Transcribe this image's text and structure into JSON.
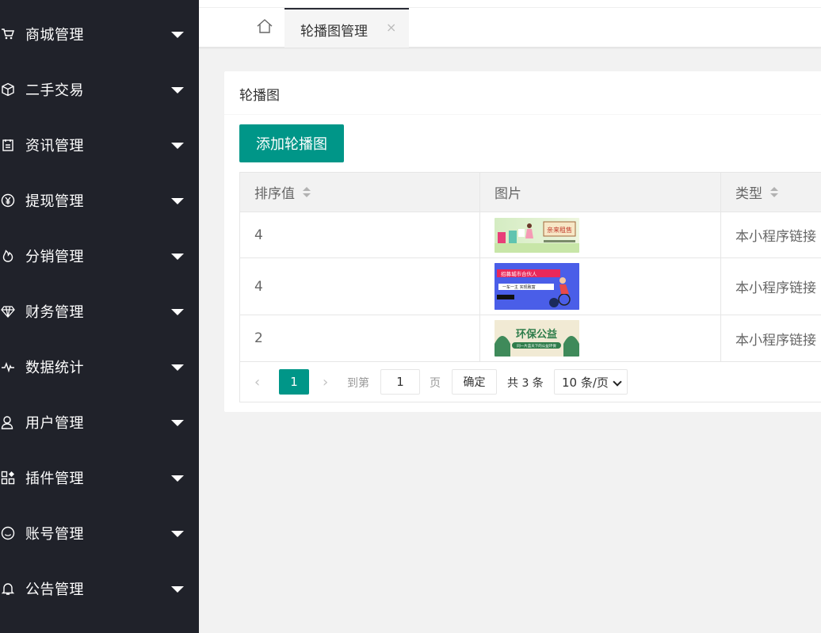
{
  "sidebar": {
    "items": [
      {
        "label": "商城管理",
        "icon": "cart-icon"
      },
      {
        "label": "二手交易",
        "icon": "box-icon"
      },
      {
        "label": "资讯管理",
        "icon": "document-icon"
      },
      {
        "label": "提现管理",
        "icon": "yen-icon"
      },
      {
        "label": "分销管理",
        "icon": "fire-icon"
      },
      {
        "label": "财务管理",
        "icon": "diamond-icon"
      },
      {
        "label": "数据统计",
        "icon": "pulse-icon"
      },
      {
        "label": "用户管理",
        "icon": "user-icon"
      },
      {
        "label": "插件管理",
        "icon": "apps-icon"
      },
      {
        "label": "账号管理",
        "icon": "smile-icon"
      },
      {
        "label": "公告管理",
        "icon": "bell-icon"
      }
    ]
  },
  "tabs": {
    "home_icon": "home-icon",
    "active_label": "轮播图管理",
    "close": "×"
  },
  "card": {
    "title": "轮播图",
    "add_button": "添加轮播图"
  },
  "table": {
    "headers": [
      "排序值",
      "图片",
      "类型"
    ],
    "rows": [
      {
        "sort": "4",
        "image": "banner-promo",
        "type": "本小程序链接"
      },
      {
        "sort": "4",
        "image": "banner-partner",
        "type": "本小程序链接"
      },
      {
        "sort": "2",
        "image": "banner-eco",
        "type": "本小程序链接"
      }
    ],
    "banners": {
      "promo_text": "亲来租售",
      "partner_text": "招募城市合伙人",
      "partner_sub": "一车一主 实现致富",
      "eco_text": "环保公益",
      "eco_sub": "同一片蓝天下的公益环保"
    }
  },
  "pager": {
    "prev": "‹",
    "current": "1",
    "next": "›",
    "goto_label": "到第",
    "input_value": "1",
    "page_label": "页",
    "ok": "确定",
    "total": "共 3 条",
    "page_size": "10 条/页"
  },
  "colors": {
    "sidebar_bg": "#20222a",
    "accent": "#009688"
  }
}
